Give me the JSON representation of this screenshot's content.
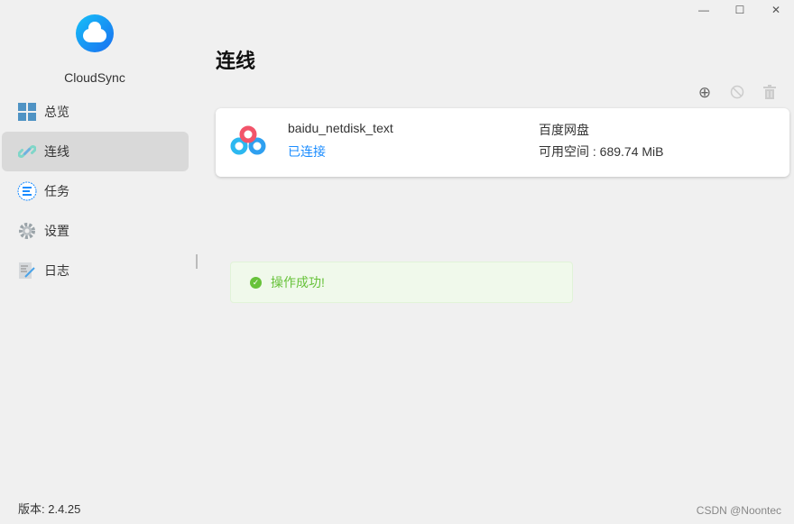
{
  "window": {
    "minimize": "—",
    "maximize": "☐",
    "close": "✕"
  },
  "app": {
    "name": "CloudSync",
    "version": "版本: 2.4.25"
  },
  "sidebar": {
    "items": [
      {
        "label": "总览",
        "icon": "grid-icon"
      },
      {
        "label": "连线",
        "icon": "link-icon",
        "active": true
      },
      {
        "label": "任务",
        "icon": "task-list-icon"
      },
      {
        "label": "设置",
        "icon": "gear-icon"
      },
      {
        "label": "日志",
        "icon": "log-icon"
      }
    ]
  },
  "page": {
    "title": "连线"
  },
  "toolbar": {
    "add": "⊕",
    "disable": "⃠",
    "delete": "🗑"
  },
  "connection": {
    "name": "baidu_netdisk_text",
    "status": "已连接",
    "type": "百度网盘",
    "space": "可用空间 : 689.74 MiB",
    "status_color": "#1a8cff"
  },
  "toast": {
    "message": "操作成功!"
  },
  "watermark": "CSDN @Noontec"
}
